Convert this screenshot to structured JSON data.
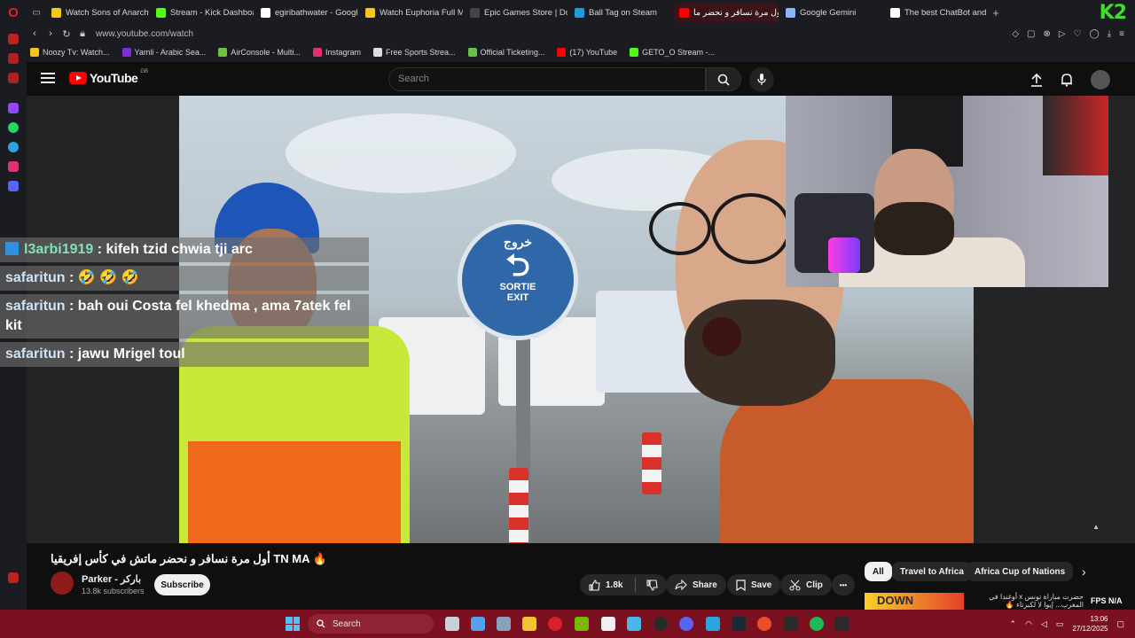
{
  "browser": {
    "tabs": [
      {
        "label": "Watch Sons of Anarchy f",
        "color": "#f5c518"
      },
      {
        "label": "Stream - Kick Dashboard",
        "color": "#53fc18"
      },
      {
        "label": "egiribathwater - Google",
        "color": "#ffffff"
      },
      {
        "label": "Watch Euphoria Full Mov",
        "color": "#f5c518"
      },
      {
        "label": "Epic Games Store | Dow",
        "color": "#444444"
      },
      {
        "label": "Ball Tag on Steam",
        "color": "#1b9be0"
      },
      {
        "label": "أول مرة نسافر و نحضر ما",
        "color": "#ff0000"
      },
      {
        "label": "Google Gemini",
        "color": "#8ab4f8"
      },
      {
        "label": "The best ChatBot and W",
        "color": "#ffffff"
      }
    ],
    "url": "www.youtube.com/watch",
    "k2_logo": "K2",
    "bookmarks": [
      {
        "label": "Noozy Tv: Watch...",
        "color": "#f5c518"
      },
      {
        "label": "Yamli - Arabic Sea...",
        "color": "#7c2fd6"
      },
      {
        "label": "AirConsole - Multi...",
        "color": "#70c040"
      },
      {
        "label": "Instagram",
        "color": "#e1306c"
      },
      {
        "label": "Free Sports Strea...",
        "color": "#dddddd"
      },
      {
        "label": "Official Ticketing...",
        "color": "#6ac048"
      },
      {
        "label": "(17) YouTube",
        "color": "#ff0000"
      },
      {
        "label": "GETO_O Stream -...",
        "color": "#53fc18"
      }
    ]
  },
  "youtube": {
    "logo_text": "YouTube",
    "country_code": "GB",
    "search_placeholder": "Search"
  },
  "chat": [
    {
      "user": "l3arbi1919",
      "message": ": kifeh tzid chwia tji arc"
    },
    {
      "user": "safaritun",
      "message": " : 🤣 🤣 🤣"
    },
    {
      "user": "safaritun",
      "message": " : bah oui Costa fel khedma , ama 7atek fel kit"
    },
    {
      "user": "safaritun",
      "message": " : jawu Mrigel toul"
    }
  ],
  "sign": {
    "arabic": "خروج",
    "text1": "SORTIE",
    "text2": "EXIT"
  },
  "video": {
    "title": "أول مرة نسافر و نحضر ماتش في كأس إفريقيا TN MA 🔥",
    "channel_name": "Parker - باركر",
    "subscribers": "13.8k subscribers",
    "subscribe_label": "Subscribe",
    "likes": "1.8k",
    "share_label": "Share",
    "save_label": "Save",
    "clip_label": "Clip",
    "more_label": "•••"
  },
  "chips": [
    "All",
    "Travel to Africa",
    "Africa Cup of Nations"
  ],
  "recommendation": {
    "thumb_text": "DOWN",
    "title": "حضرت مباراة تونس x أوغندا في المغرب... إيوا لا لكبرتاء 🔥"
  },
  "fps_label": "FPS N/A",
  "taskbar": {
    "search_label": "Search",
    "time": "13:06",
    "date": "27/12/2025"
  }
}
